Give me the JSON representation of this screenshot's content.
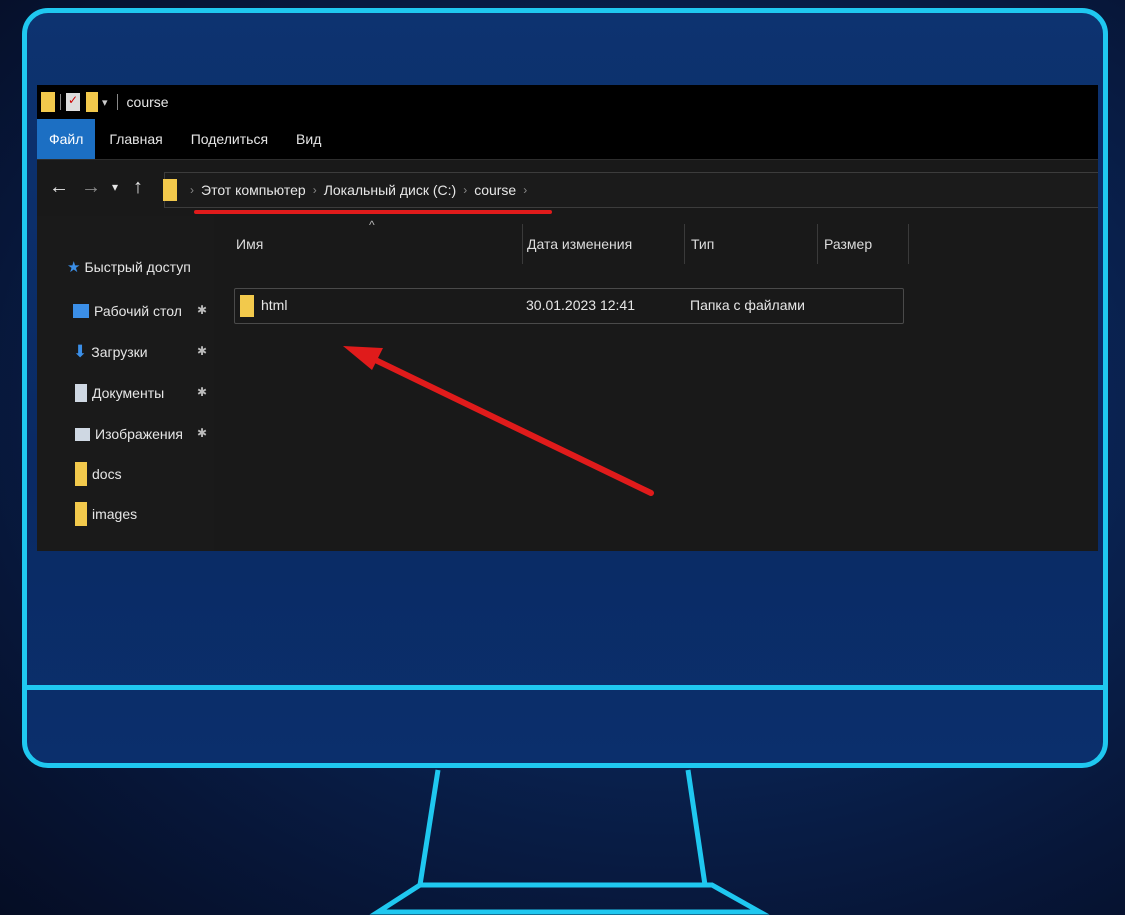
{
  "window": {
    "title": "course"
  },
  "ribbon": {
    "tabs": [
      "Файл",
      "Главная",
      "Поделиться",
      "Вид"
    ]
  },
  "nav": {
    "back_icon": "arrow-left-icon",
    "forward_icon": "arrow-right-icon",
    "recent_icon": "chevron-down-icon",
    "up_icon": "arrow-up-icon"
  },
  "breadcrumb": [
    "Этот компьютер",
    "Локальный диск (C:)",
    "course"
  ],
  "sidebar": {
    "items": [
      {
        "label": "Быстрый доступ",
        "icon": "star-icon",
        "color": "#3b8fe8"
      },
      {
        "label": "Рабочий стол",
        "icon": "desktop-icon",
        "color": "#3b8fe8",
        "pinned": true
      },
      {
        "label": "Загрузки",
        "icon": "download-icon",
        "color": "#3b8fe8",
        "pinned": true
      },
      {
        "label": "Документы",
        "icon": "document-icon",
        "color": "#cfd8e3",
        "pinned": true
      },
      {
        "label": "Изображения",
        "icon": "picture-icon",
        "color": "#cfd8e3",
        "pinned": true
      },
      {
        "label": "docs",
        "icon": "folder-icon",
        "color": "#f2c94c"
      },
      {
        "label": "images",
        "icon": "folder-icon",
        "color": "#f2c94c"
      }
    ]
  },
  "columns": [
    "Имя",
    "Дата изменения",
    "Тип",
    "Размер"
  ],
  "files": [
    {
      "name": "html",
      "modified": "30.01.2023 12:41",
      "type": "Папка с файлами",
      "size": ""
    }
  ],
  "colors": {
    "frame": "#1fc8f0",
    "accent": "#1c6fc3",
    "annotation": "#e01b1b",
    "folder": "#f2c94c"
  }
}
